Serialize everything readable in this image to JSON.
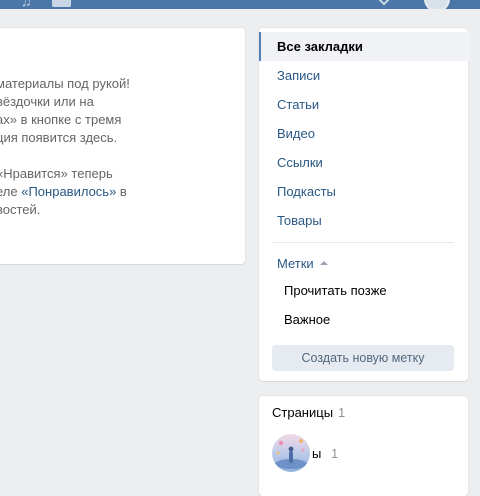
{
  "header": {
    "icons": [
      "music-icon",
      "square-icon",
      "notification-icon",
      "avatar-icon"
    ]
  },
  "main": {
    "info_lines_1": [
      "материалы под рукой!",
      "вёздочки или на",
      "ах» в кнопке с тремя",
      "ция появится здесь."
    ],
    "info_line2_1": "«Нравится» теперь",
    "info_line2_2_pre": "еле ",
    "info_line2_2_link": "«Понравилось»",
    "info_line2_2_post": " в",
    "info_line2_3": "востей."
  },
  "menu": {
    "items": [
      "Все закладки",
      "Записи",
      "Статьи",
      "Видео",
      "Ссылки",
      "Подкасты",
      "Товары"
    ],
    "active_index": 0,
    "tags_label": "Метки",
    "tags": [
      "Прочитать позже",
      "Важное"
    ],
    "create_button": "Создать новую метку"
  },
  "pages": {
    "title": "Страницы",
    "count": "1",
    "item": {
      "name": "ы",
      "count": "1"
    }
  },
  "colors": {
    "header": "#4a76a8",
    "link": "#2a5885",
    "background": "#edeef0",
    "active_border": "#5181b8"
  }
}
